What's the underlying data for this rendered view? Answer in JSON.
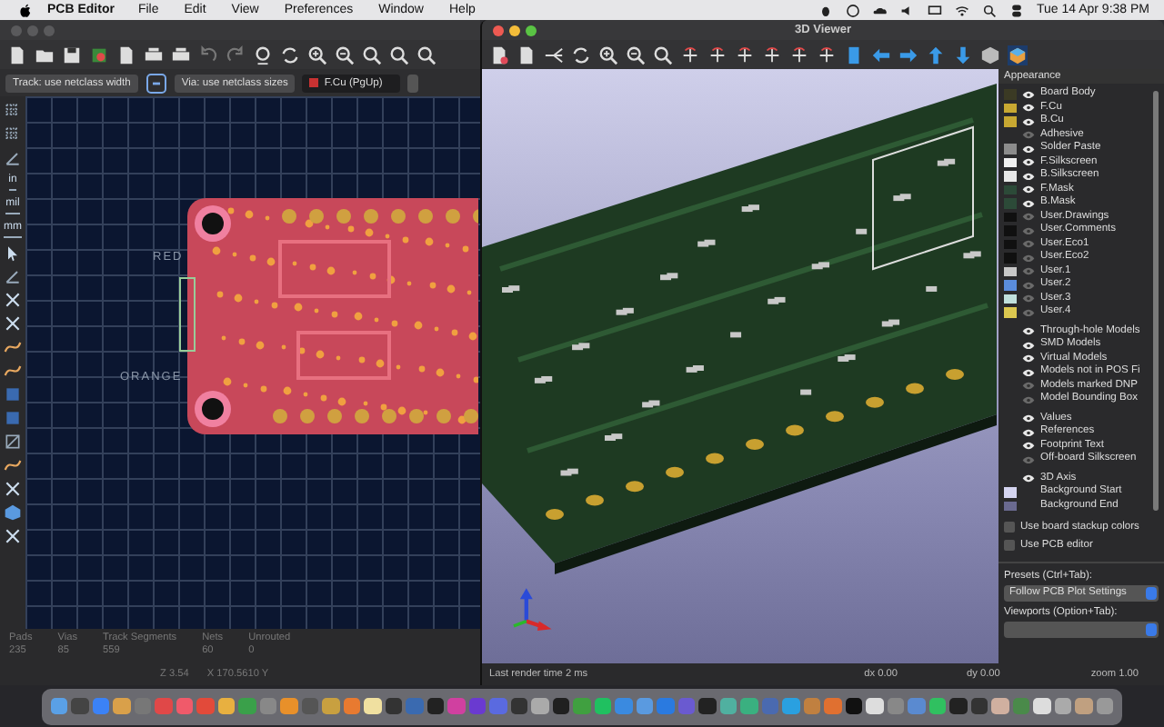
{
  "menubar": {
    "app": "PCB Editor",
    "menus": [
      "File",
      "Edit",
      "View",
      "Preferences",
      "Window",
      "Help"
    ],
    "clock": "Tue 14 Apr  9:38 PM"
  },
  "pcb_editor": {
    "track_width": "Track: use netclass width",
    "via_size": "Via: use netclass sizes",
    "layer": "F.Cu (PgUp)",
    "unit_buttons": [
      "in",
      "mil",
      "mm"
    ],
    "canvas_labels": [
      "RED",
      "ORANGE"
    ],
    "stats": [
      {
        "label": "Pads",
        "value": "235"
      },
      {
        "label": "Vias",
        "value": "85"
      },
      {
        "label": "Track Segments",
        "value": "559"
      },
      {
        "label": "Nets",
        "value": "60"
      },
      {
        "label": "Unrouted",
        "value": "0"
      }
    ],
    "coords": [
      "Z 3.54",
      "X 170.5610  Y"
    ]
  },
  "viewer": {
    "title": "3D Viewer",
    "appearance_title": "Appearance",
    "groups": [
      [
        {
          "name": "Board Body",
          "color": "#3b3a24",
          "visible": true
        },
        {
          "name": "F.Cu",
          "color": "#c8a832",
          "visible": true
        },
        {
          "name": "B.Cu",
          "color": "#c8a832",
          "visible": true
        },
        {
          "name": "Adhesive",
          "visible": false
        },
        {
          "name": "Solder Paste",
          "color": "#8c8c8c",
          "visible": true
        },
        {
          "name": "F.Silkscreen",
          "color": "#f0f0f0",
          "visible": true
        },
        {
          "name": "B.Silkscreen",
          "color": "#e8e8e8",
          "visible": true
        },
        {
          "name": "F.Mask",
          "color": "#2c4a38",
          "visible": true
        },
        {
          "name": "B.Mask",
          "color": "#2c4a38",
          "visible": true
        },
        {
          "name": "User.Drawings",
          "color": "#101010",
          "visible": false
        },
        {
          "name": "User.Comments",
          "color": "#101010",
          "visible": false
        },
        {
          "name": "User.Eco1",
          "color": "#101010",
          "visible": false
        },
        {
          "name": "User.Eco2",
          "color": "#101010",
          "visible": false
        },
        {
          "name": "User.1",
          "color": "#c8c8c8",
          "visible": false
        },
        {
          "name": "User.2",
          "color": "#5a8cdc",
          "visible": false
        },
        {
          "name": "User.3",
          "color": "#c0e0dc",
          "visible": false
        },
        {
          "name": "User.4",
          "color": "#dcc850",
          "visible": false
        }
      ],
      [
        {
          "name": "Through-hole Models",
          "visible": true
        },
        {
          "name": "SMD Models",
          "visible": true
        },
        {
          "name": "Virtual Models",
          "visible": true
        },
        {
          "name": "Models not in POS Fi",
          "visible": true
        },
        {
          "name": "Models marked DNP",
          "visible": false
        },
        {
          "name": "Model Bounding Box",
          "visible": false
        }
      ],
      [
        {
          "name": "Values",
          "visible": true
        },
        {
          "name": "References",
          "visible": true
        },
        {
          "name": "Footprint Text",
          "visible": true
        },
        {
          "name": "Off-board Silkscreen",
          "visible": false
        }
      ],
      [
        {
          "name": "3D Axis",
          "visible": true
        },
        {
          "name": "Background Start",
          "color": "#d4d4f0"
        },
        {
          "name": "Background End",
          "color": "#6a6a90"
        }
      ]
    ],
    "options": [
      {
        "label": "Use board stackup colors",
        "checked": false
      },
      {
        "label": "Use PCB editor",
        "checked": false
      }
    ],
    "presets_label": "Presets (Ctrl+Tab):",
    "preset": "Follow PCB Plot Settings",
    "viewports_label": "Viewports (Option+Tab):",
    "status": [
      "Last render time 2 ms",
      "dx 0.00",
      "dy 0.00",
      "zoom 1.00"
    ]
  }
}
